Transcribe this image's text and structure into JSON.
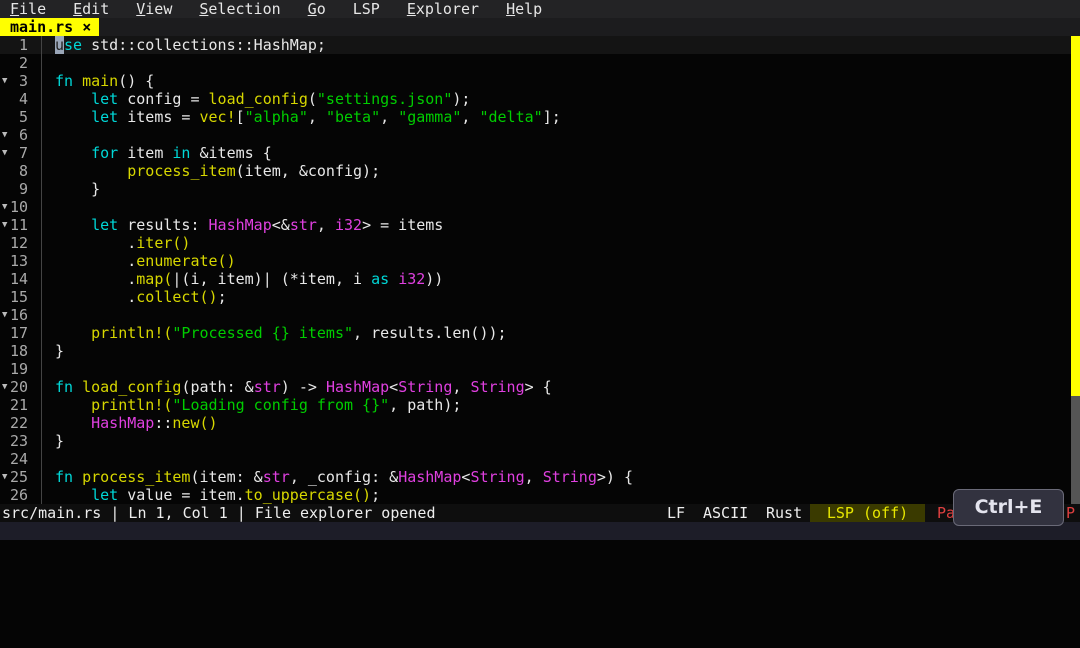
{
  "menu": [
    {
      "label": "File",
      "u": "F",
      "rest": "ile"
    },
    {
      "label": "Edit",
      "u": "E",
      "rest": "dit"
    },
    {
      "label": "View",
      "u": "V",
      "rest": "iew"
    },
    {
      "label": "Selection",
      "u": "S",
      "rest": "election"
    },
    {
      "label": "Go",
      "u": "G",
      "rest": "o"
    },
    {
      "label": "LSP",
      "u": "",
      "rest": "LSP"
    },
    {
      "label": "Explorer",
      "u": "E",
      "rest": "xplorer"
    },
    {
      "label": "Help",
      "u": "H",
      "rest": "elp"
    }
  ],
  "tab": {
    "label": "main.rs ×"
  },
  "editor": {
    "current_line": 1,
    "folds": [
      3,
      6,
      7,
      10,
      11,
      16,
      20,
      25
    ],
    "lines": [
      [
        [
          "cur",
          "u"
        ],
        [
          "k",
          "se"
        ],
        [
          "p",
          " std::collections::HashMap;"
        ]
      ],
      [],
      [
        [
          "k",
          "fn"
        ],
        [
          "p",
          " "
        ],
        [
          "f",
          "main"
        ],
        [
          "p",
          "() {"
        ]
      ],
      [
        [
          "p",
          "    "
        ],
        [
          "k",
          "let"
        ],
        [
          "p",
          " config = "
        ],
        [
          "f",
          "load_config"
        ],
        [
          "p",
          "("
        ],
        [
          "s",
          "\"settings.json\""
        ],
        [
          "p",
          ");"
        ]
      ],
      [
        [
          "p",
          "    "
        ],
        [
          "k",
          "let"
        ],
        [
          "p",
          " items = "
        ],
        [
          "f",
          "vec!"
        ],
        [
          "p",
          "["
        ],
        [
          "s",
          "\"alpha\""
        ],
        [
          "p",
          ", "
        ],
        [
          "s",
          "\"beta\""
        ],
        [
          "p",
          ", "
        ],
        [
          "s",
          "\"gamma\""
        ],
        [
          "p",
          ", "
        ],
        [
          "s",
          "\"delta\""
        ],
        [
          "p",
          "];"
        ]
      ],
      [],
      [
        [
          "p",
          "    "
        ],
        [
          "k",
          "for"
        ],
        [
          "p",
          " item "
        ],
        [
          "k",
          "in"
        ],
        [
          "p",
          " &items {"
        ]
      ],
      [
        [
          "p",
          "        "
        ],
        [
          "f",
          "process_item"
        ],
        [
          "p",
          "(item, &config);"
        ]
      ],
      [
        [
          "p",
          "    }"
        ]
      ],
      [],
      [
        [
          "p",
          "    "
        ],
        [
          "k",
          "let"
        ],
        [
          "p",
          " results: "
        ],
        [
          "t",
          "HashMap"
        ],
        [
          "p",
          "<&"
        ],
        [
          "t",
          "str"
        ],
        [
          "p",
          ", "
        ],
        [
          "t",
          "i32"
        ],
        [
          "p",
          "> = items"
        ]
      ],
      [
        [
          "p",
          "        ."
        ],
        [
          "f",
          "iter()"
        ]
      ],
      [
        [
          "p",
          "        ."
        ],
        [
          "f",
          "enumerate()"
        ]
      ],
      [
        [
          "p",
          "        ."
        ],
        [
          "f",
          "map("
        ],
        [
          "p",
          "|(i, item)| (*item, i "
        ],
        [
          "k",
          "as"
        ],
        [
          "p",
          " "
        ],
        [
          "t",
          "i32"
        ],
        [
          "p",
          "))"
        ]
      ],
      [
        [
          "p",
          "        ."
        ],
        [
          "f",
          "collect()"
        ],
        [
          "p",
          ";"
        ]
      ],
      [],
      [
        [
          "p",
          "    "
        ],
        [
          "f",
          "println!("
        ],
        [
          "s",
          "\"Processed {} items\""
        ],
        [
          "p",
          ", results.len());"
        ]
      ],
      [
        [
          "p",
          "}"
        ]
      ],
      [],
      [
        [
          "k",
          "fn"
        ],
        [
          "p",
          " "
        ],
        [
          "f",
          "load_config"
        ],
        [
          "p",
          "(path: &"
        ],
        [
          "t",
          "str"
        ],
        [
          "p",
          ") -> "
        ],
        [
          "t",
          "HashMap"
        ],
        [
          "p",
          "<"
        ],
        [
          "t",
          "String"
        ],
        [
          "p",
          ", "
        ],
        [
          "t",
          "String"
        ],
        [
          "p",
          "> {"
        ]
      ],
      [
        [
          "p",
          "    "
        ],
        [
          "f",
          "println!("
        ],
        [
          "s",
          "\"Loading config from {}\""
        ],
        [
          "p",
          ", path);"
        ]
      ],
      [
        [
          "p",
          "    "
        ],
        [
          "t",
          "HashMap"
        ],
        [
          "p",
          "::"
        ],
        [
          "f",
          "new()"
        ]
      ],
      [
        [
          "p",
          "}"
        ]
      ],
      [],
      [
        [
          "k",
          "fn"
        ],
        [
          "p",
          " "
        ],
        [
          "f",
          "process_item"
        ],
        [
          "p",
          "(item: &"
        ],
        [
          "t",
          "str"
        ],
        [
          "p",
          ", _config: &"
        ],
        [
          "t",
          "HashMap"
        ],
        [
          "p",
          "<"
        ],
        [
          "t",
          "String"
        ],
        [
          "p",
          ", "
        ],
        [
          "t",
          "String"
        ],
        [
          "p",
          ">) {"
        ]
      ],
      [
        [
          "p",
          "    "
        ],
        [
          "k",
          "let"
        ],
        [
          "p",
          " value = item."
        ],
        [
          "f",
          "to_uppercase()"
        ],
        [
          "p",
          ";"
        ]
      ]
    ]
  },
  "scrollbar": {
    "visible_fraction": 0.77,
    "position": 0
  },
  "status": {
    "left": "src/main.rs | Ln 1, Col 1 | File explorer opened",
    "eol": "LF",
    "encoding": "ASCII",
    "language": "Rust",
    "lsp": "LSP (off)",
    "truncated_left": "Pa",
    "truncated_right": "P"
  },
  "shortcut_overlay": "Ctrl+E"
}
